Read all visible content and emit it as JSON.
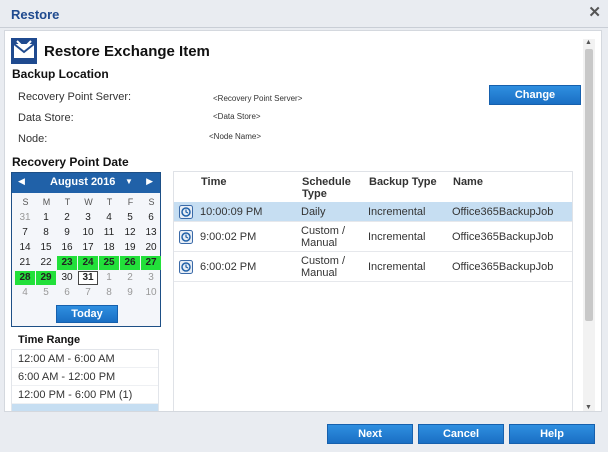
{
  "window": {
    "title": "Restore",
    "close_glyph": "✕"
  },
  "heading": {
    "title": "Restore Exchange Item",
    "icon": "restore-exchange-icon"
  },
  "backup_location": {
    "title": "Backup Location",
    "rows": [
      {
        "label": "Recovery Point Server:",
        "value": "<Recovery Point Server>"
      },
      {
        "label": "Data Store:",
        "value": "<Data Store>"
      },
      {
        "label": "Node:",
        "value": "<Node Name>"
      }
    ],
    "change_button": "Change"
  },
  "recovery_point_date": {
    "title": "Recovery Point Date",
    "calendar": {
      "month_label": "August 2016",
      "weekdays": [
        "S",
        "M",
        "T",
        "W",
        "T",
        "F",
        "S"
      ],
      "weeks": [
        [
          {
            "d": "31",
            "dim": true
          },
          {
            "d": "1"
          },
          {
            "d": "2"
          },
          {
            "d": "3"
          },
          {
            "d": "4"
          },
          {
            "d": "5"
          },
          {
            "d": "6"
          }
        ],
        [
          {
            "d": "7"
          },
          {
            "d": "8"
          },
          {
            "d": "9"
          },
          {
            "d": "10"
          },
          {
            "d": "11"
          },
          {
            "d": "12"
          },
          {
            "d": "13"
          }
        ],
        [
          {
            "d": "14"
          },
          {
            "d": "15"
          },
          {
            "d": "16"
          },
          {
            "d": "17"
          },
          {
            "d": "18"
          },
          {
            "d": "19"
          },
          {
            "d": "20"
          }
        ],
        [
          {
            "d": "21"
          },
          {
            "d": "22"
          },
          {
            "d": "23",
            "rp": true
          },
          {
            "d": "24",
            "rp": true
          },
          {
            "d": "25",
            "rp": true
          },
          {
            "d": "26",
            "rp": true
          },
          {
            "d": "27",
            "rp": true
          }
        ],
        [
          {
            "d": "28",
            "rp": true
          },
          {
            "d": "29",
            "rp": true
          },
          {
            "d": "30"
          },
          {
            "d": "31",
            "sel": true
          },
          {
            "d": "1",
            "dim": true
          },
          {
            "d": "2",
            "dim": true
          },
          {
            "d": "3",
            "dim": true
          }
        ],
        [
          {
            "d": "4",
            "dim": true
          },
          {
            "d": "5",
            "dim": true
          },
          {
            "d": "6",
            "dim": true
          },
          {
            "d": "7",
            "dim": true
          },
          {
            "d": "8",
            "dim": true
          },
          {
            "d": "9",
            "dim": true
          },
          {
            "d": "10",
            "dim": true
          }
        ]
      ],
      "today_button": "Today",
      "highlight_color": "#22e03a"
    }
  },
  "time_range": {
    "title": "Time Range",
    "items": [
      "12:00 AM - 6:00 AM",
      "6:00 AM - 12:00 PM",
      "12:00 PM - 6:00 PM   (1)"
    ]
  },
  "table": {
    "headers": {
      "time": "Time",
      "schedule_type": "Schedule Type",
      "backup_type": "Backup Type",
      "name": "Name"
    },
    "rows": [
      {
        "time": "10:00:09 PM",
        "schedule_type": "Daily",
        "backup_type": "Incremental",
        "name": "Office365BackupJob",
        "selected": true
      },
      {
        "time": "9:00:02 PM",
        "schedule_type": "Custom / Manual",
        "backup_type": "Incremental",
        "name": "Office365BackupJob",
        "selected": false
      },
      {
        "time": "6:00:02 PM",
        "schedule_type": "Custom / Manual",
        "backup_type": "Incremental",
        "name": "Office365BackupJob",
        "selected": false
      }
    ],
    "row_icon": "recovery-point-icon"
  },
  "footer": {
    "next": "Next",
    "cancel": "Cancel",
    "help": "Help"
  },
  "colors": {
    "accent": "#1a6fc4",
    "title": "#1f4a8f",
    "selection": "#c6def2"
  }
}
